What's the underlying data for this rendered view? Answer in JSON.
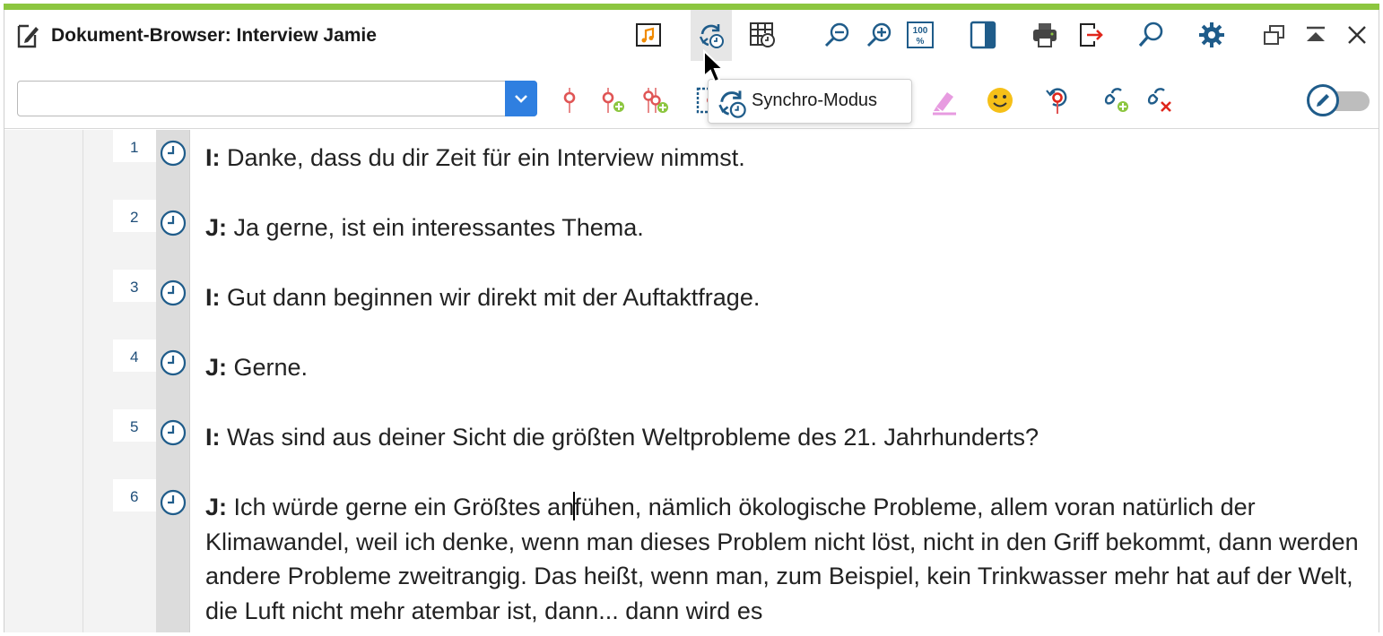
{
  "window": {
    "title": "Dokument-Browser: Interview Jamie",
    "accent_color": "#8cc63f",
    "icon_color": "#1f5c8a"
  },
  "titlebar_icons": [
    "media-player-icon",
    "synchro-mode-icon",
    "table-clock-icon",
    "zoom-out-icon",
    "zoom-in-icon",
    "zoom-100-icon",
    "panel-toggle-icon",
    "print-icon",
    "export-icon",
    "search-icon",
    "settings-gear-icon",
    "restore-window-icon",
    "collapse-up-icon",
    "close-icon"
  ],
  "toolbar": {
    "combo_value": "",
    "icons": [
      "code-pin-icon",
      "code-pin-add-icon",
      "multi-code-pin-add-icon",
      "selection-box-icon",
      "highlighter-icon",
      "emoticon-icon",
      "undo-code-icon",
      "link-add-icon",
      "link-remove-icon"
    ],
    "edit_toggle_state": "off"
  },
  "tooltip": {
    "text": "Synchro-Modus"
  },
  "paragraphs": [
    {
      "num": "1",
      "speaker": "I:",
      "text": " Danke, dass du dir Zeit für ein Interview nimmst."
    },
    {
      "num": "2",
      "speaker": "J:",
      "text": " Ja gerne, ist ein interessantes Thema."
    },
    {
      "num": "3",
      "speaker": "I:",
      "text": " Gut dann beginnen wir direkt mit der Auftaktfrage."
    },
    {
      "num": "4",
      "speaker": "J:",
      "text": " Gerne."
    },
    {
      "num": "5",
      "speaker": "I:",
      "text": " Was sind aus deiner Sicht die größten Weltprobleme des 21. Jahrhunderts?"
    },
    {
      "num": "6",
      "speaker": "J:",
      "text_before_caret": " Ich würde gerne ein Größtes an",
      "text_after_caret": "fühen, nämlich ökologische Probleme, allem voran natürlich der Klimawandel, weil ich denke, wenn man dieses Problem nicht löst, nicht in den Griff bekommt, dann werden andere Probleme zweitrangig. Das heißt, wenn man, zum Beispiel, kein Trinkwasser mehr hat auf der Welt, die Luft nicht mehr atembar ist, dann... dann wird es"
    }
  ]
}
